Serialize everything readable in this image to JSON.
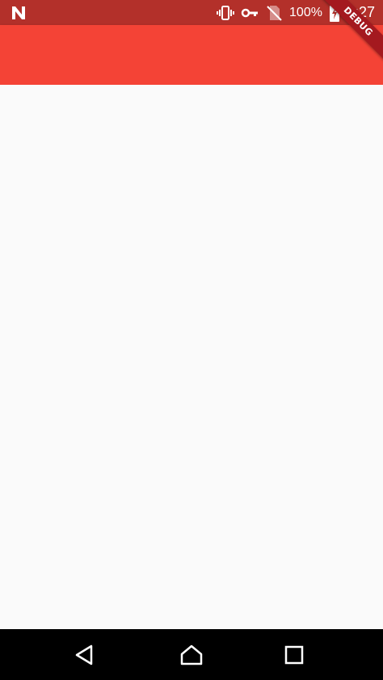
{
  "status_bar": {
    "battery_percent": "100%",
    "time": "6:27",
    "icons": [
      "notification-n-icon",
      "vibrate-icon",
      "vpn-key-icon",
      "no-sim-icon",
      "battery-charging-icon"
    ]
  },
  "debug_banner": {
    "label": "DEBUG"
  },
  "colors": {
    "status_bar": "#b3302a",
    "app_bar": "#f44336",
    "background": "#fafafa",
    "nav_bar": "#000000",
    "debug_banner": "#a4191f"
  },
  "nav_bar": {
    "buttons": [
      "back-icon",
      "home-icon",
      "recents-icon"
    ]
  }
}
